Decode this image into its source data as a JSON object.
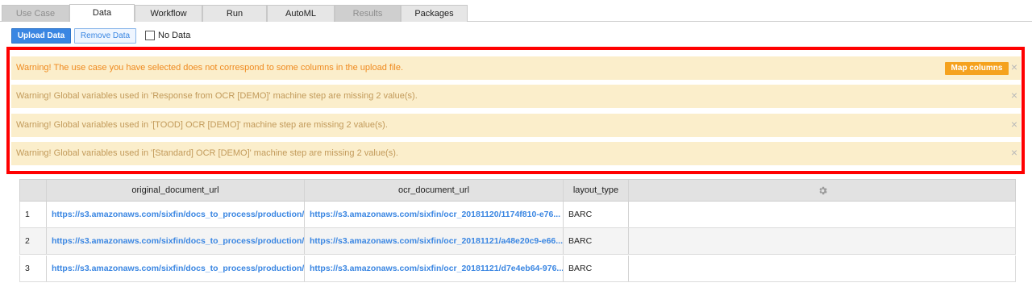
{
  "tabs": [
    {
      "label": "Use Case",
      "state": "disabled"
    },
    {
      "label": "Data",
      "state": "active"
    },
    {
      "label": "Workflow",
      "state": "normal"
    },
    {
      "label": "Run",
      "state": "normal"
    },
    {
      "label": "AutoML",
      "state": "normal"
    },
    {
      "label": "Results",
      "state": "disabled"
    },
    {
      "label": "Packages",
      "state": "normal"
    }
  ],
  "toolbar": {
    "upload_label": "Upload Data",
    "remove_label": "Remove Data",
    "no_data_label": "No Data",
    "no_data_checked": false
  },
  "warnings": [
    {
      "prefix": "Warning!",
      "message": "The use case you have selected does not correspond to some columns in the upload file.",
      "action_label": "Map columns",
      "close": "×"
    },
    {
      "prefix": "Warning!",
      "message": "Global variables used in 'Response from OCR [DEMO]' machine step are missing 2 value(s).",
      "close": "×"
    },
    {
      "prefix": "Warning!",
      "message": "Global variables used in '[TOOD] OCR [DEMO]' machine step are missing 2 value(s).",
      "close": "×"
    },
    {
      "prefix": "Warning!",
      "message": "Global variables used in '[Standard] OCR [DEMO]' machine step are missing 2 value(s).",
      "close": "×"
    }
  ],
  "table": {
    "columns": [
      "",
      "original_document_url",
      "ocr_document_url",
      "layout_type",
      ""
    ],
    "settings_icon": "gear-icon",
    "rows": [
      {
        "index": "1",
        "original": "https://s3.amazonaws.com/sixfin/docs_to_process/production/...",
        "ocr": "https://s3.amazonaws.com/sixfin/ocr_20181120/1174f810-e76...",
        "layout": "BARC"
      },
      {
        "index": "2",
        "original": "https://s3.amazonaws.com/sixfin/docs_to_process/production/...",
        "ocr": "https://s3.amazonaws.com/sixfin/ocr_20181121/a48e20c9-e66...",
        "layout": "BARC"
      },
      {
        "index": "3",
        "original": "https://s3.amazonaws.com/sixfin/docs_to_process/production/...",
        "ocr": "https://s3.amazonaws.com/sixfin/ocr_20181121/d7e4eb64-976...",
        "layout": "BARC"
      }
    ]
  },
  "colors": {
    "accent": "#3a86e2",
    "warning_bg": "#fbeecb",
    "warning_text": "#ef8a1f",
    "map_button": "#f5a21e",
    "highlight": "#ff0000"
  }
}
